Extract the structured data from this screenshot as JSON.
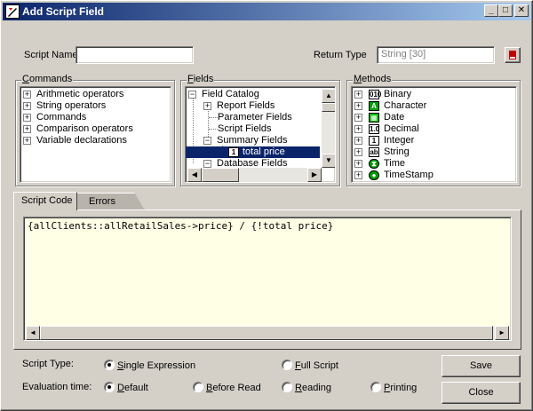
{
  "window": {
    "title": "Add Script Field"
  },
  "form": {
    "script_name_label": "Script Name",
    "script_name_value": "",
    "return_type_label": "Return Type",
    "return_type_value": "String [30]"
  },
  "commands": {
    "label": "Commands",
    "items": [
      "Arithmetic operators",
      "String operators",
      "Commands",
      "Comparison operators",
      "Variable declarations"
    ]
  },
  "fields": {
    "label": "Fields",
    "items": [
      {
        "label": "Field Catalog"
      },
      {
        "label": "Report Fields"
      },
      {
        "label": "Parameter Fields"
      },
      {
        "label": "Script Fields"
      },
      {
        "label": "Summary Fields"
      },
      {
        "label": "total price",
        "badge": "1"
      },
      {
        "label": "Database Fields"
      }
    ]
  },
  "methods": {
    "label": "Methods",
    "items": [
      {
        "label": "Binary",
        "icon": "binary-icon",
        "glyph": "010"
      },
      {
        "label": "Character",
        "icon": "character-icon",
        "glyph": "A"
      },
      {
        "label": "Date",
        "icon": "date-icon",
        "glyph": "▦"
      },
      {
        "label": "Decimal",
        "icon": "decimal-icon",
        "glyph": "1.0"
      },
      {
        "label": "Integer",
        "icon": "integer-icon",
        "glyph": "1"
      },
      {
        "label": "String",
        "icon": "string-icon",
        "glyph": "ab"
      },
      {
        "label": "Time",
        "icon": "time-icon",
        "glyph": "⧗"
      },
      {
        "label": "TimeStamp",
        "icon": "timestamp-icon",
        "glyph": "●"
      }
    ]
  },
  "tabs": [
    {
      "label": "Script Code"
    },
    {
      "label": "Errors"
    }
  ],
  "code": {
    "text": "{allClients::allRetailSales->price} / {!total price}"
  },
  "options": {
    "script_type_label": "Script Type:",
    "single_expression": "Single Expression",
    "full_script": "Full Script",
    "evaluation_time_label": "Evaluation time:",
    "default": "Default",
    "before_read": "Before Read",
    "reading": "Reading",
    "printing": "Printing"
  },
  "buttons": {
    "save": "Save",
    "close": "Close"
  },
  "colors": {
    "titlebar_start": "#0a246a",
    "titlebar_end": "#a6caf0",
    "selection": "#0a246a",
    "code_bg": "#ffffe6",
    "face": "#d4d0c8"
  }
}
